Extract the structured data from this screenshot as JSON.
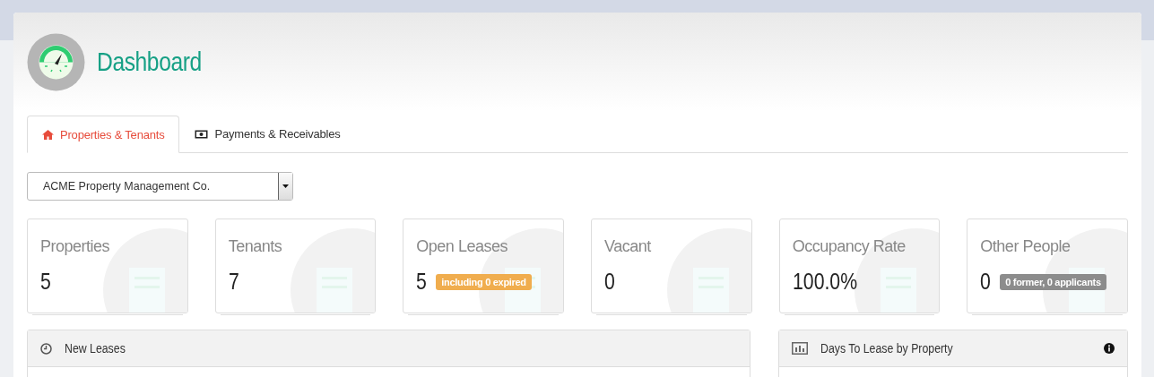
{
  "page": {
    "title": "Dashboard"
  },
  "tabs": [
    {
      "label": "Properties & Tenants",
      "selected": true
    },
    {
      "label": "Payments & Receivables",
      "selected": false
    }
  ],
  "company_select": {
    "value": "ACME Property Management Co."
  },
  "stats": [
    {
      "label": "Properties",
      "value": "5"
    },
    {
      "label": "Tenants",
      "value": "7"
    },
    {
      "label": "Open Leases",
      "value": "5",
      "badge": {
        "text": "including 0 expired",
        "color": "#f0ad4e"
      }
    },
    {
      "label": "Vacant",
      "value": "0"
    },
    {
      "label": "Occupancy Rate",
      "value": "100.0%"
    },
    {
      "label": "Other People",
      "value": "0",
      "badge": {
        "text": "0 former, 0 applicants",
        "color": "#8c8c8c"
      }
    }
  ],
  "panels": [
    {
      "title": "New Leases",
      "info": false
    },
    {
      "title": "Days To Lease by Property",
      "info": true
    }
  ]
}
